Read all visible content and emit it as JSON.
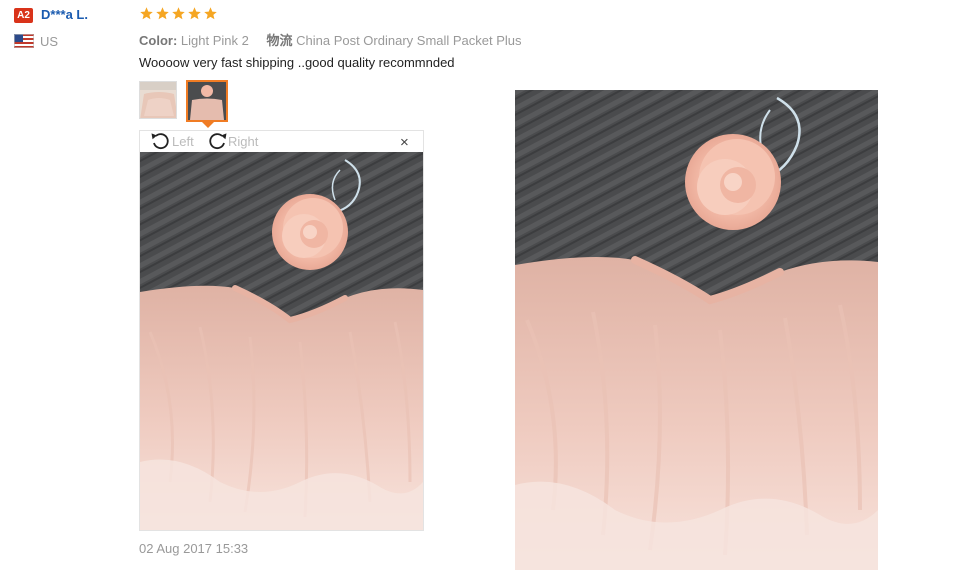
{
  "reviewer": {
    "level_badge": "A2",
    "name": "D***a L.",
    "country": "US"
  },
  "review": {
    "rating": 5,
    "color_label": "Color:",
    "color_value": "Light Pink 2",
    "logistics_label": "物流",
    "logistics_value": "China Post Ordinary Small Packet Plus",
    "comment": "Woooow very fast shipping ..good quality recommnded",
    "date": "02 Aug 2017 15:33"
  },
  "viewer": {
    "rotate_left_label": "Left",
    "rotate_right_label": "Right",
    "close_label": "×"
  },
  "icons": {
    "star": "star-icon",
    "rotate_left": "rotate-left-icon",
    "rotate_right": "rotate-right-icon",
    "close": "close-icon",
    "flag": "us-flag-icon"
  },
  "colors": {
    "star": "#f5a623",
    "badge": "#d9331a",
    "name": "#1a5bb0",
    "active_thumb": "#f07c24"
  }
}
